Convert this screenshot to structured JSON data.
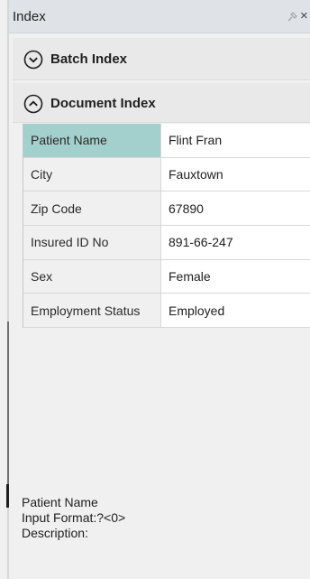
{
  "window": {
    "title": "Index",
    "close_glyph": "×"
  },
  "sections": {
    "batch_label": "Batch Index",
    "document_label": "Document Index"
  },
  "fields": [
    {
      "label": "Patient Name",
      "value": "Flint Fran",
      "selected": true
    },
    {
      "label": "City",
      "value": "Fauxtown",
      "selected": false
    },
    {
      "label": "Zip Code",
      "value": "67890",
      "selected": false
    },
    {
      "label": "Insured ID No",
      "value": "891-66-247",
      "selected": false
    },
    {
      "label": "Sex",
      "value": "Female",
      "selected": false
    },
    {
      "label": "Employment Status",
      "value": "Employed",
      "selected": false
    }
  ],
  "description": {
    "field_name": "Patient Name",
    "input_format": "Input Format:?<0>",
    "description": "Description:"
  },
  "colors": {
    "selected_row": "#a3cfcc",
    "title_bar": "#dfe3e8"
  }
}
